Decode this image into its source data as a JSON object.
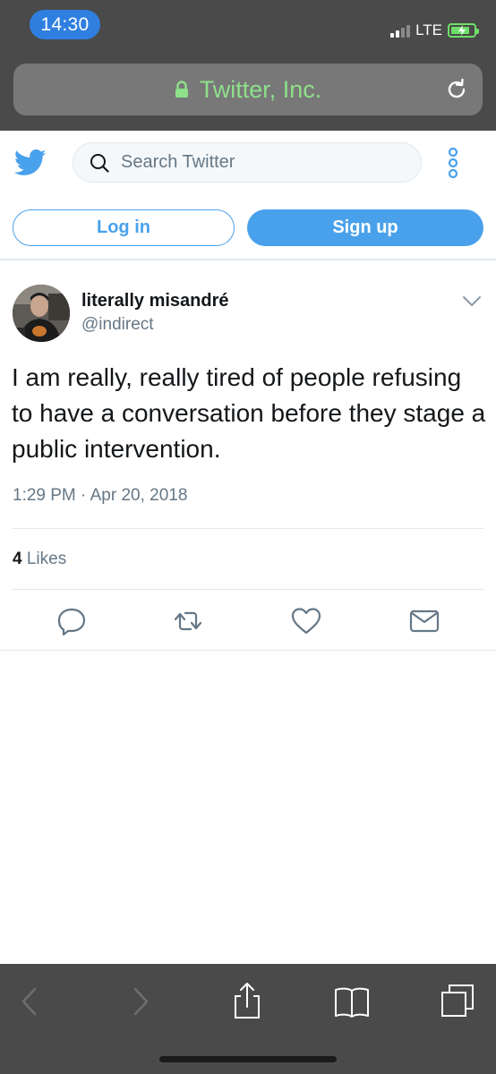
{
  "status_bar": {
    "time": "14:30",
    "network": "LTE"
  },
  "browser": {
    "url_title": "Twitter, Inc.",
    "lock_icon": "lock-icon",
    "reload_icon": "reload-icon",
    "toolbar_icons": [
      "back-icon",
      "forward-icon",
      "share-icon",
      "bookmarks-icon",
      "tabs-icon"
    ]
  },
  "header": {
    "search_placeholder": "Search Twitter",
    "login_label": "Log in",
    "signup_label": "Sign up"
  },
  "tweet": {
    "display_name": "literally misandré",
    "handle": "@indirect",
    "text": "I am really, really tired of people refusing to have a conversation before they stage a public intervention.",
    "timestamp": "1:29 PM · Apr 20, 2018",
    "likes_count": "4",
    "likes_label": "Likes"
  },
  "colors": {
    "accent": "#4aa1eb",
    "time_pill": "#2f7fe0",
    "secure_green": "#8ee08a",
    "chrome": "#4a4a4a"
  }
}
